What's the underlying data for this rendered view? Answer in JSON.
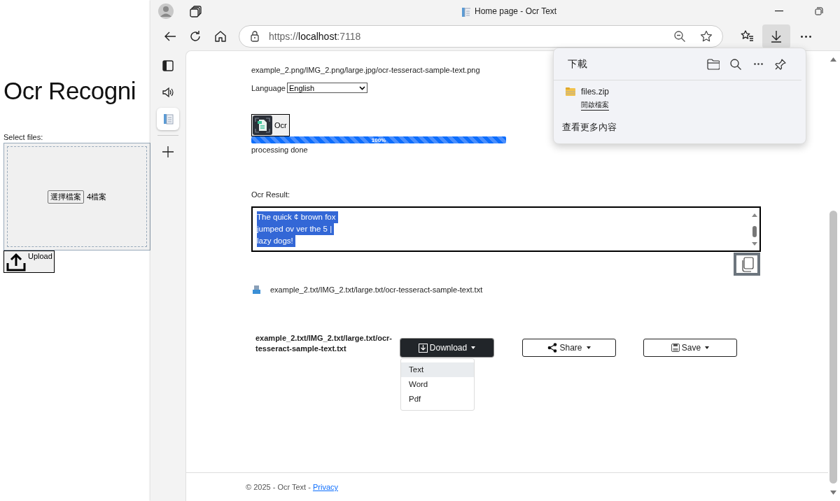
{
  "background_page": {
    "title": "Ocr Recogni",
    "select_label": "Select files:",
    "choose_button": "選擇檔案",
    "file_count": "4檔案",
    "upload_button": "Upload"
  },
  "browser": {
    "tab_title": "Home page - Ocr Text",
    "address": {
      "scheme": "https://",
      "host": "localhost",
      "port": ":7118"
    },
    "downloads_button": {
      "selected": true
    }
  },
  "sidebar": [
    {
      "kind": "layout",
      "selected": false
    },
    {
      "kind": "sound",
      "selected": false
    },
    {
      "kind": "page",
      "selected": true
    },
    {
      "kind": "add",
      "selected": false
    }
  ],
  "page": {
    "files_line": "example_2.png/IMG_2.png/large.jpg/ocr-tesseract-sample-text.png",
    "language": {
      "label": "Language",
      "value": "English"
    },
    "ocr_button": "Ocr",
    "progress": {
      "level": 1,
      "label": "100%"
    },
    "status": "processing done",
    "result_label": "Ocr Result:",
    "result": {
      "lines": [
        "The quick ¢ brown fox ",
        "jumped ov ver the 5 | ",
        "lazy dogs! "
      ],
      "selected": true
    },
    "output_file": "example_2.txt/IMG_2.txt/large.txt/ocr-tesseract-sample-text.txt",
    "actions": {
      "file_name": "example_2.txt/IMG_2.txt/large.txt/ocr-tesseract-sample-text.txt",
      "buttons": [
        {
          "kind": "download",
          "label": "Download",
          "expanded": true
        },
        {
          "kind": "share",
          "label": "Share",
          "expanded": false
        },
        {
          "kind": "save",
          "label": "Save",
          "expanded": false
        }
      ]
    },
    "download_menu": [
      {
        "label": "Text",
        "selected": true
      },
      {
        "label": "Word",
        "selected": false
      },
      {
        "label": "Pdf",
        "selected": false
      }
    ],
    "footer": {
      "text": "© 2025 - Ocr Text - ",
      "link": "Privacy"
    }
  },
  "downloads_panel": {
    "title": "下載",
    "items": [
      {
        "name": "files.zip",
        "action": "開啟檔案"
      }
    ],
    "more": "查看更多內容"
  }
}
